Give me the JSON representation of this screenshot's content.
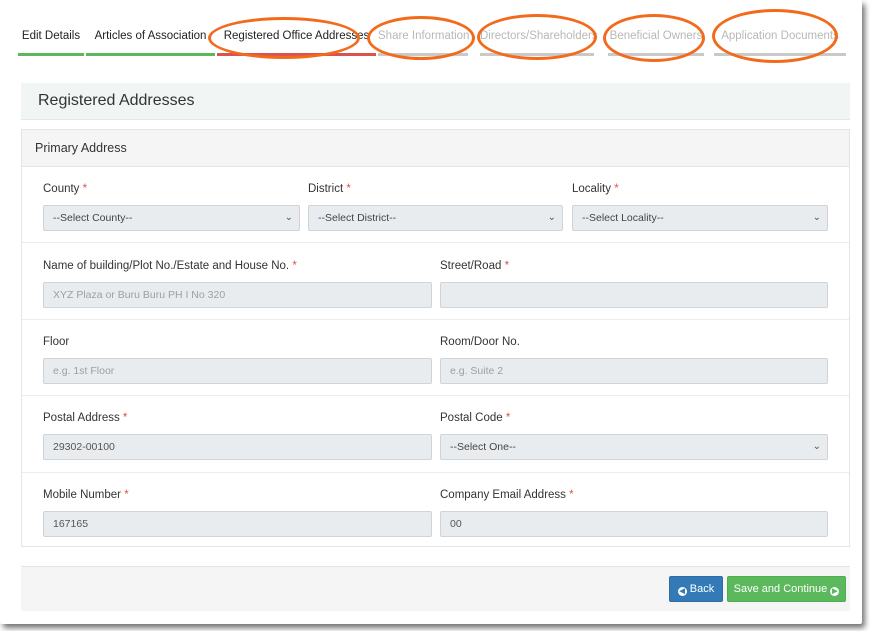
{
  "tabs": [
    {
      "label": "Edit Details",
      "state": "done"
    },
    {
      "label": "Articles of Association",
      "state": "done"
    },
    {
      "label": "Registered Office Addresses",
      "state": "active"
    },
    {
      "label": "Share Information",
      "state": "pending"
    },
    {
      "label": "Directors/Shareholders",
      "state": "pending"
    },
    {
      "label": "Beneficial Owners",
      "state": "pending"
    },
    {
      "label": "Application Documents",
      "state": "pending"
    }
  ],
  "page": {
    "title": "Registered Addresses",
    "section_title": "Primary Address"
  },
  "form": {
    "county": {
      "label": "County",
      "value": "--Select County--"
    },
    "district": {
      "label": "District",
      "value": "--Select District--"
    },
    "locality": {
      "label": "Locality",
      "value": "--Select Locality--"
    },
    "building": {
      "label": "Name of building/Plot No./Estate and House No.",
      "placeholder": "XYZ Plaza or Buru Buru PH I No 320"
    },
    "street": {
      "label": "Street/Road",
      "value": ""
    },
    "floor": {
      "label": "Floor",
      "placeholder": "e.g. 1st Floor"
    },
    "room": {
      "label": "Room/Door No.",
      "placeholder": "e.g. Suite 2"
    },
    "postal_address": {
      "label": "Postal Address",
      "value": "29302-00100"
    },
    "postal_code": {
      "label": "Postal Code",
      "value": "--Select One--"
    },
    "mobile": {
      "label": "Mobile Number",
      "value": "167165"
    },
    "email": {
      "label": "Company Email Address",
      "value": "00"
    },
    "required_marker": "*"
  },
  "buttons": {
    "back": "Back",
    "save": "Save and Continue"
  },
  "colors": {
    "done": "#5cb85c",
    "active": "#d9534f",
    "pending": "#c9c9c9",
    "annotation": "#f26b1d",
    "back_button": "#337ab7",
    "save_button": "#5cb85c"
  },
  "icons": {
    "back": "arrow-circle-left-icon",
    "save": "arrow-circle-right-icon",
    "select": "chevron-down-icon"
  }
}
